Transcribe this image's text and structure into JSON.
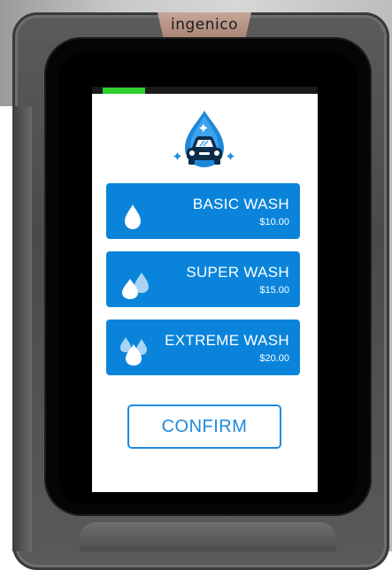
{
  "terminal": {
    "brand": "ingenico",
    "progress_fraction": 0.2
  },
  "options": [
    {
      "name": "BASIC WASH",
      "price": "$10.00",
      "icon": "single-drop-icon"
    },
    {
      "name": "SUPER WASH",
      "price": "$15.00",
      "icon": "two-drops-icon"
    },
    {
      "name": "EXTREME WASH",
      "price": "$20.00",
      "icon": "three-drops-icon"
    }
  ],
  "confirm_label": "CONFIRM",
  "colors": {
    "accent": "#0a84db",
    "progress": "#2fcf2c",
    "confirm_border": "#1c8be0"
  },
  "logo_icon": "car-wash-drop-icon"
}
